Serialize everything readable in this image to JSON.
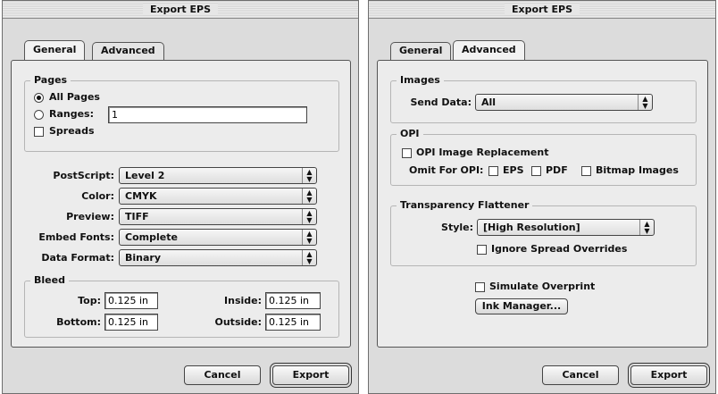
{
  "left_dialog": {
    "title": "Export EPS",
    "tabs": [
      {
        "label": "General"
      },
      {
        "label": "Advanced"
      }
    ],
    "pages": {
      "label": "Pages",
      "all_pages_label": "All Pages",
      "all_pages_selected": true,
      "ranges_label": "Ranges:",
      "ranges_value": "1",
      "spreads_label": "Spreads",
      "spreads_checked": false
    },
    "settings": {
      "postscript_label": "PostScript:",
      "postscript_value": "Level 2",
      "color_label": "Color:",
      "color_value": "CMYK",
      "preview_label": "Preview:",
      "preview_value": "TIFF",
      "embed_fonts_label": "Embed Fonts:",
      "embed_fonts_value": "Complete",
      "data_format_label": "Data Format:",
      "data_format_value": "Binary"
    },
    "bleed": {
      "label": "Bleed",
      "top_label": "Top:",
      "top_value": "0.125 in",
      "bottom_label": "Bottom:",
      "bottom_value": "0.125 in",
      "inside_label": "Inside:",
      "inside_value": "0.125 in",
      "outside_label": "Outside:",
      "outside_value": "0.125 in"
    },
    "buttons": {
      "cancel": "Cancel",
      "export": "Export"
    }
  },
  "right_dialog": {
    "title": "Export EPS",
    "tabs": [
      {
        "label": "General"
      },
      {
        "label": "Advanced"
      }
    ],
    "images": {
      "label": "Images",
      "send_data_label": "Send Data:",
      "send_data_value": "All"
    },
    "opi": {
      "label": "OPI",
      "replacement_label": "OPI Image Replacement",
      "omit_label": "Omit For OPI:",
      "eps_label": "EPS",
      "pdf_label": "PDF",
      "bitmap_label": "Bitmap Images"
    },
    "flattener": {
      "label": "Transparency Flattener",
      "style_label": "Style:",
      "style_value": "[High Resolution]",
      "ignore_label": "Ignore Spread Overrides"
    },
    "simulate_overprint_label": "Simulate Overprint",
    "ink_manager_label": "Ink Manager...",
    "buttons": {
      "cancel": "Cancel",
      "export": "Export"
    }
  },
  "icons": {
    "popup_arrows": "up-down-arrows-icon"
  }
}
